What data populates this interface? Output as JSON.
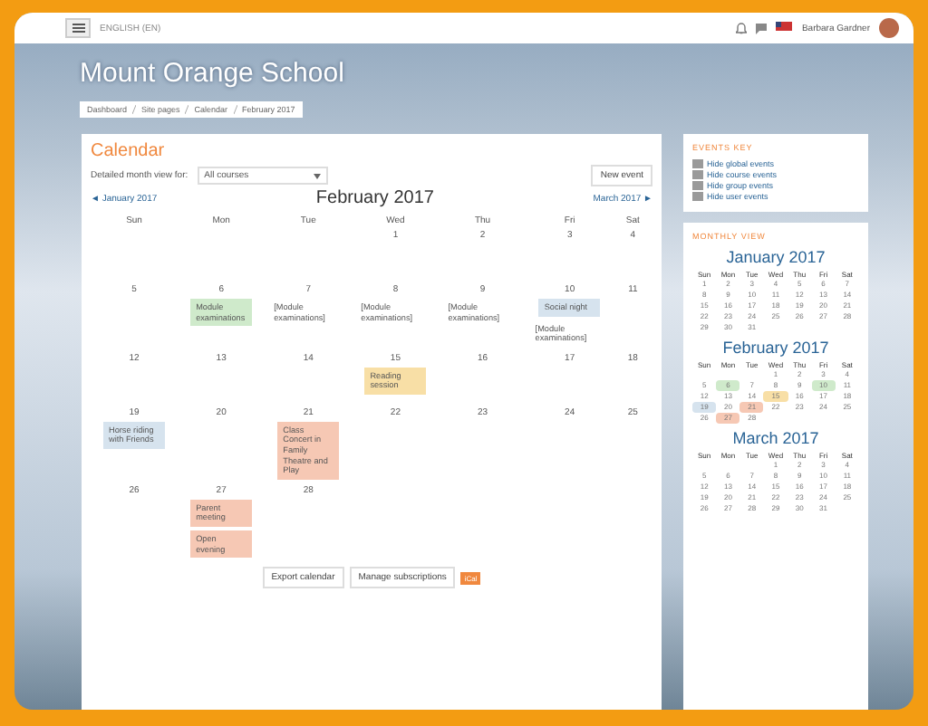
{
  "navbar": {
    "language": "ENGLISH (EN)",
    "user": "Barbara Gardner"
  },
  "header": {
    "site_title": "Mount Orange School",
    "breadcrumb": [
      "Dashboard",
      "Site pages",
      "Calendar",
      "February 2017"
    ]
  },
  "calendar": {
    "title": "Calendar",
    "filter_label": "Detailed month view for:",
    "course_select": "All courses",
    "new_event": "New event",
    "prev": "◄ January 2017",
    "month": "February 2017",
    "next": "March 2017 ►",
    "weekdays": [
      "Sun",
      "Mon",
      "Tue",
      "Wed",
      "Thu",
      "Fri",
      "Sat"
    ],
    "weeks": [
      {
        "kind": "first",
        "days": [
          {
            "day": "1"
          },
          {
            "day": "2"
          },
          {
            "day": "3"
          },
          {
            "day": "4"
          }
        ]
      },
      {
        "kind": "full",
        "days": [
          {
            "day": "5"
          },
          {
            "day": "6",
            "events": [
              {
                "kind": "badge",
                "title": "Module examinations",
                "color": "#cfeacb"
              }
            ]
          },
          {
            "day": "7",
            "events": [
              {
                "kind": "plain",
                "title": "[Module examinations]"
              }
            ]
          },
          {
            "day": "8",
            "events": [
              {
                "kind": "plain",
                "title": "[Module examinations]"
              }
            ]
          },
          {
            "day": "9",
            "events": [
              {
                "kind": "plain",
                "title": "[Module examinations]"
              }
            ]
          },
          {
            "day": "10",
            "events": [
              {
                "kind": "badge",
                "title": "Social night",
                "color": "#d6e3ee"
              },
              {
                "kind": "plain",
                "title": "[Module examinations]"
              }
            ]
          },
          {
            "day": "11"
          }
        ]
      },
      {
        "kind": "full",
        "days": [
          {
            "day": "12"
          },
          {
            "day": "13"
          },
          {
            "day": "14"
          },
          {
            "day": "15",
            "events": [
              {
                "kind": "badge",
                "title": "Reading session",
                "color": "#f8dfa6"
              }
            ]
          },
          {
            "day": "16"
          },
          {
            "day": "17"
          },
          {
            "day": "18"
          }
        ]
      },
      {
        "kind": "full",
        "days": [
          {
            "day": "19",
            "events": [
              {
                "kind": "badge",
                "title": "Horse riding with Friends",
                "color": "#d6e3ee"
              }
            ]
          },
          {
            "day": "20"
          },
          {
            "day": "21",
            "events": [
              {
                "kind": "badge",
                "title": "Class Concert in Family Theatre and Play",
                "color": "#f6c8b4"
              }
            ]
          },
          {
            "day": "22"
          },
          {
            "day": "23"
          },
          {
            "day": "24"
          },
          {
            "day": "25"
          }
        ]
      },
      {
        "kind": "last",
        "days": [
          {
            "day": "26"
          },
          {
            "day": "27",
            "events": [
              {
                "kind": "badge",
                "title": "Parent meeting",
                "color": "#f6c8b4"
              },
              {
                "kind": "badge",
                "title": "Open evening",
                "color": "#f6c8b4"
              }
            ]
          },
          {
            "day": "28"
          }
        ]
      }
    ],
    "buttons": [
      "Export calendar",
      "Manage subscriptions"
    ],
    "ical": "iCal"
  },
  "events_key": {
    "title": "EVENTS KEY",
    "items": [
      "Hide global events",
      "Hide course events",
      "Hide group events",
      "Hide user events"
    ]
  },
  "monthly_view": {
    "title": "MONTHLY VIEW",
    "months": [
      {
        "name": "January 2017",
        "weekdays": [
          "Sun",
          "Mon",
          "Tue",
          "Wed",
          "Thu",
          "Fri",
          "Sat"
        ],
        "weeks": [
          {
            "kind": "full",
            "days": [
              {
                "day": "1"
              },
              {
                "day": "2"
              },
              {
                "day": "3"
              },
              {
                "day": "4"
              },
              {
                "day": "5"
              },
              {
                "day": "6"
              },
              {
                "day": "7"
              }
            ]
          },
          {
            "kind": "full",
            "days": [
              {
                "day": "8"
              },
              {
                "day": "9"
              },
              {
                "day": "10"
              },
              {
                "day": "11"
              },
              {
                "day": "12"
              },
              {
                "day": "13"
              },
              {
                "day": "14"
              }
            ]
          },
          {
            "kind": "full",
            "days": [
              {
                "day": "15"
              },
              {
                "day": "16"
              },
              {
                "day": "17"
              },
              {
                "day": "18"
              },
              {
                "day": "19"
              },
              {
                "day": "20"
              },
              {
                "day": "21"
              }
            ]
          },
          {
            "kind": "full",
            "days": [
              {
                "day": "22"
              },
              {
                "day": "23"
              },
              {
                "day": "24"
              },
              {
                "day": "25"
              },
              {
                "day": "26"
              },
              {
                "day": "27"
              },
              {
                "day": "28"
              }
            ]
          },
          {
            "kind": "last",
            "days": [
              {
                "day": "29"
              },
              {
                "day": "30"
              },
              {
                "day": "31"
              }
            ]
          }
        ]
      },
      {
        "name": "February 2017",
        "weekdays": [
          "Sun",
          "Mon",
          "Tue",
          "Wed",
          "Thu",
          "Fri",
          "Sat"
        ],
        "weeks": [
          {
            "kind": "first",
            "days": [
              {
                "day": "1"
              },
              {
                "day": "2"
              },
              {
                "day": "3"
              },
              {
                "day": "4"
              }
            ]
          },
          {
            "kind": "full",
            "days": [
              {
                "day": "5"
              },
              {
                "day": "6",
                "color": "#cfeacb"
              },
              {
                "day": "7"
              },
              {
                "day": "8"
              },
              {
                "day": "9"
              },
              {
                "day": "10",
                "color": "#cfeacb"
              },
              {
                "day": "11"
              }
            ]
          },
          {
            "kind": "full",
            "days": [
              {
                "day": "12"
              },
              {
                "day": "13"
              },
              {
                "day": "14"
              },
              {
                "day": "15",
                "color": "#f8dfa6"
              },
              {
                "day": "16"
              },
              {
                "day": "17"
              },
              {
                "day": "18"
              }
            ]
          },
          {
            "kind": "full",
            "days": [
              {
                "day": "19",
                "color": "#d6e3ee"
              },
              {
                "day": "20"
              },
              {
                "day": "21",
                "color": "#f6c8b4"
              },
              {
                "day": "22"
              },
              {
                "day": "23"
              },
              {
                "day": "24"
              },
              {
                "day": "25"
              }
            ]
          },
          {
            "kind": "last",
            "days": [
              {
                "day": "26"
              },
              {
                "day": "27",
                "color": "#f6c8b4"
              },
              {
                "day": "28"
              }
            ]
          }
        ]
      },
      {
        "name": "March 2017",
        "weekdays": [
          "Sun",
          "Mon",
          "Tue",
          "Wed",
          "Thu",
          "Fri",
          "Sat"
        ],
        "weeks": [
          {
            "kind": "first",
            "days": [
              {
                "day": "1"
              },
              {
                "day": "2"
              },
              {
                "day": "3"
              },
              {
                "day": "4"
              }
            ]
          },
          {
            "kind": "full",
            "days": [
              {
                "day": "5"
              },
              {
                "day": "6"
              },
              {
                "day": "7"
              },
              {
                "day": "8"
              },
              {
                "day": "9"
              },
              {
                "day": "10"
              },
              {
                "day": "11"
              }
            ]
          },
          {
            "kind": "full",
            "days": [
              {
                "day": "12"
              },
              {
                "day": "13"
              },
              {
                "day": "14"
              },
              {
                "day": "15"
              },
              {
                "day": "16"
              },
              {
                "day": "17"
              },
              {
                "day": "18"
              }
            ]
          },
          {
            "kind": "full",
            "days": [
              {
                "day": "19"
              },
              {
                "day": "20"
              },
              {
                "day": "21"
              },
              {
                "day": "22"
              },
              {
                "day": "23"
              },
              {
                "day": "24"
              },
              {
                "day": "25"
              }
            ]
          },
          {
            "kind": "last",
            "days": [
              {
                "day": "26"
              },
              {
                "day": "27"
              },
              {
                "day": "28"
              },
              {
                "day": "29"
              },
              {
                "day": "30"
              },
              {
                "day": "31"
              }
            ]
          }
        ]
      }
    ]
  }
}
